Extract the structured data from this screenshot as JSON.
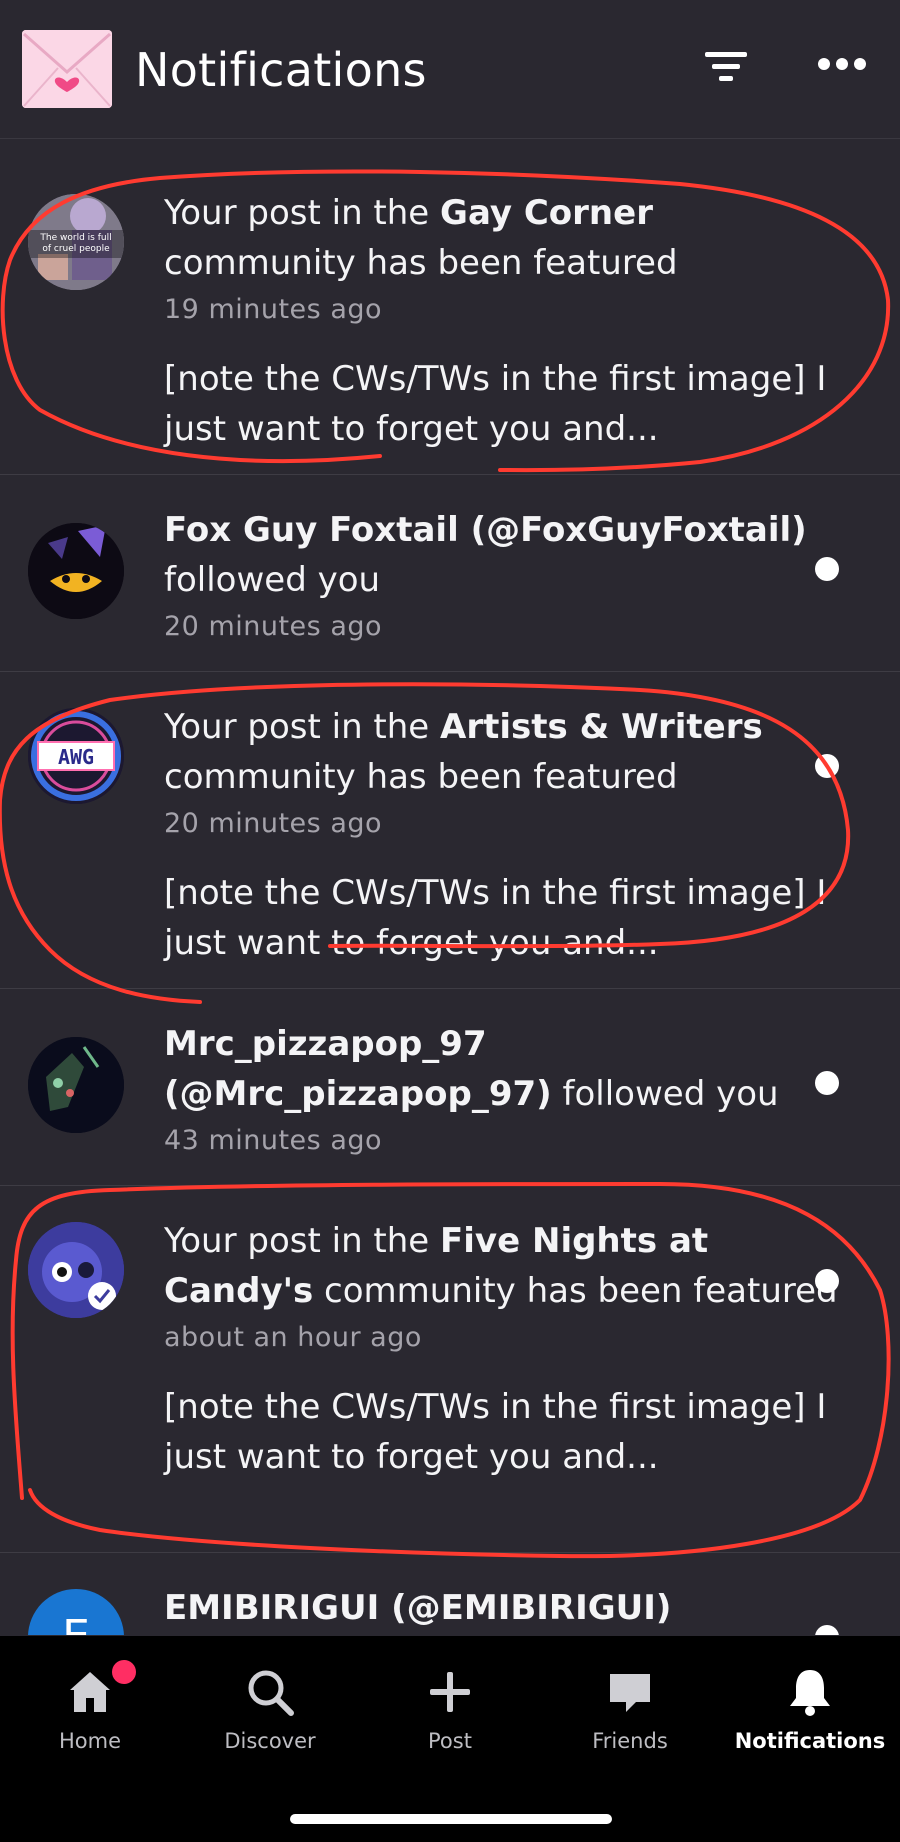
{
  "header": {
    "title": "Notifications",
    "icons": {
      "app": "envelope-heart-icon",
      "filter": "filter-icon",
      "more": "more-horizontal-icon"
    }
  },
  "notifications": [
    {
      "avatar_caption": "The world is full of cruel people",
      "text_before": "Your post in the ",
      "bold": "Gay Corner",
      "text_after": " community has been featured",
      "time": "19 minutes ago",
      "snippet": "[note the CWs/TWs in the first image] I just want to forget you and...",
      "unread": false
    },
    {
      "bold": "Fox Guy Foxtail (@FoxGuyFoxtail)",
      "text_after": " followed you",
      "time": "20 minutes ago",
      "unread": true
    },
    {
      "avatar_caption": "AWG",
      "text_before": "Your post in the ",
      "bold": "Artists & Writers",
      "text_after": " community has been featured",
      "time": "20 minutes ago",
      "snippet": "[note the CWs/TWs in the first image] I just want to forget you and...",
      "unread": true
    },
    {
      "bold": "Mrc_pizzapop_97 (@Mrc_pizzapop_97)",
      "text_after": " followed you",
      "time": "43 minutes ago",
      "unread": true
    },
    {
      "text_before": "Your post in the ",
      "bold": "Five Nights at Candy's",
      "text_after": " community has been featured",
      "time": "about an hour ago",
      "snippet": "[note the CWs/TWs in the first image] I just want to forget you and...",
      "unread": true
    },
    {
      "avatar_letter": "E",
      "bold": "EMIBIRIGUI (@EMIBIRIGUI)",
      "unread": true
    }
  ],
  "tabbar": {
    "tabs": [
      {
        "label": "Home",
        "icon": "home-icon",
        "badge": true
      },
      {
        "label": "Discover",
        "icon": "search-icon"
      },
      {
        "label": "Post",
        "icon": "plus-icon"
      },
      {
        "label": "Friends",
        "icon": "chat-bubble-icon"
      },
      {
        "label": "Notifications",
        "icon": "bell-icon",
        "active": true
      }
    ]
  },
  "colors": {
    "background": "#2a2830",
    "tabbar": "#000000",
    "badge": "#ff2e63",
    "annotation_stroke": "#ff3b30",
    "muted_text": "#a5a3ab"
  }
}
